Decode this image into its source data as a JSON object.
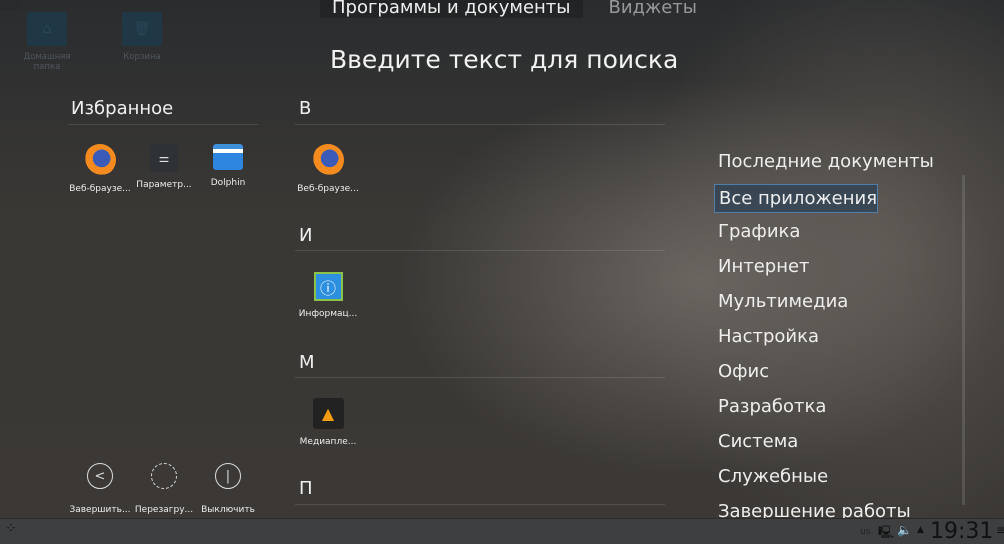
{
  "desktop": {
    "home": "Домашняя папка",
    "trash": "Корзина"
  },
  "tabs": [
    "Программы и документы",
    "Виджеты"
  ],
  "search": {
    "placeholder": "Введите текст для поиска"
  },
  "favorites": {
    "title": "Избранное",
    "items": [
      "Веб-браузе...",
      "Параметр...",
      "Dolphin"
    ]
  },
  "apps": {
    "sections": [
      {
        "letter": "В",
        "items": [
          "Веб-браузе..."
        ]
      },
      {
        "letter": "И",
        "items": [
          "Информац..."
        ]
      },
      {
        "letter": "М",
        "items": [
          "Медиапле..."
        ]
      },
      {
        "letter": "П",
        "items": []
      }
    ]
  },
  "categories": [
    "Последние документы",
    "Все приложения",
    "Графика",
    "Интернет",
    "Мультимедиа",
    "Настройка",
    "Офис",
    "Разработка",
    "Система",
    "Служебные",
    "Завершение работы"
  ],
  "selected_category": "Все приложения",
  "power": [
    "Завершить...",
    "Перезагру...",
    "Выключить"
  ],
  "tray": {
    "layout": "us",
    "clock": "19:31"
  }
}
